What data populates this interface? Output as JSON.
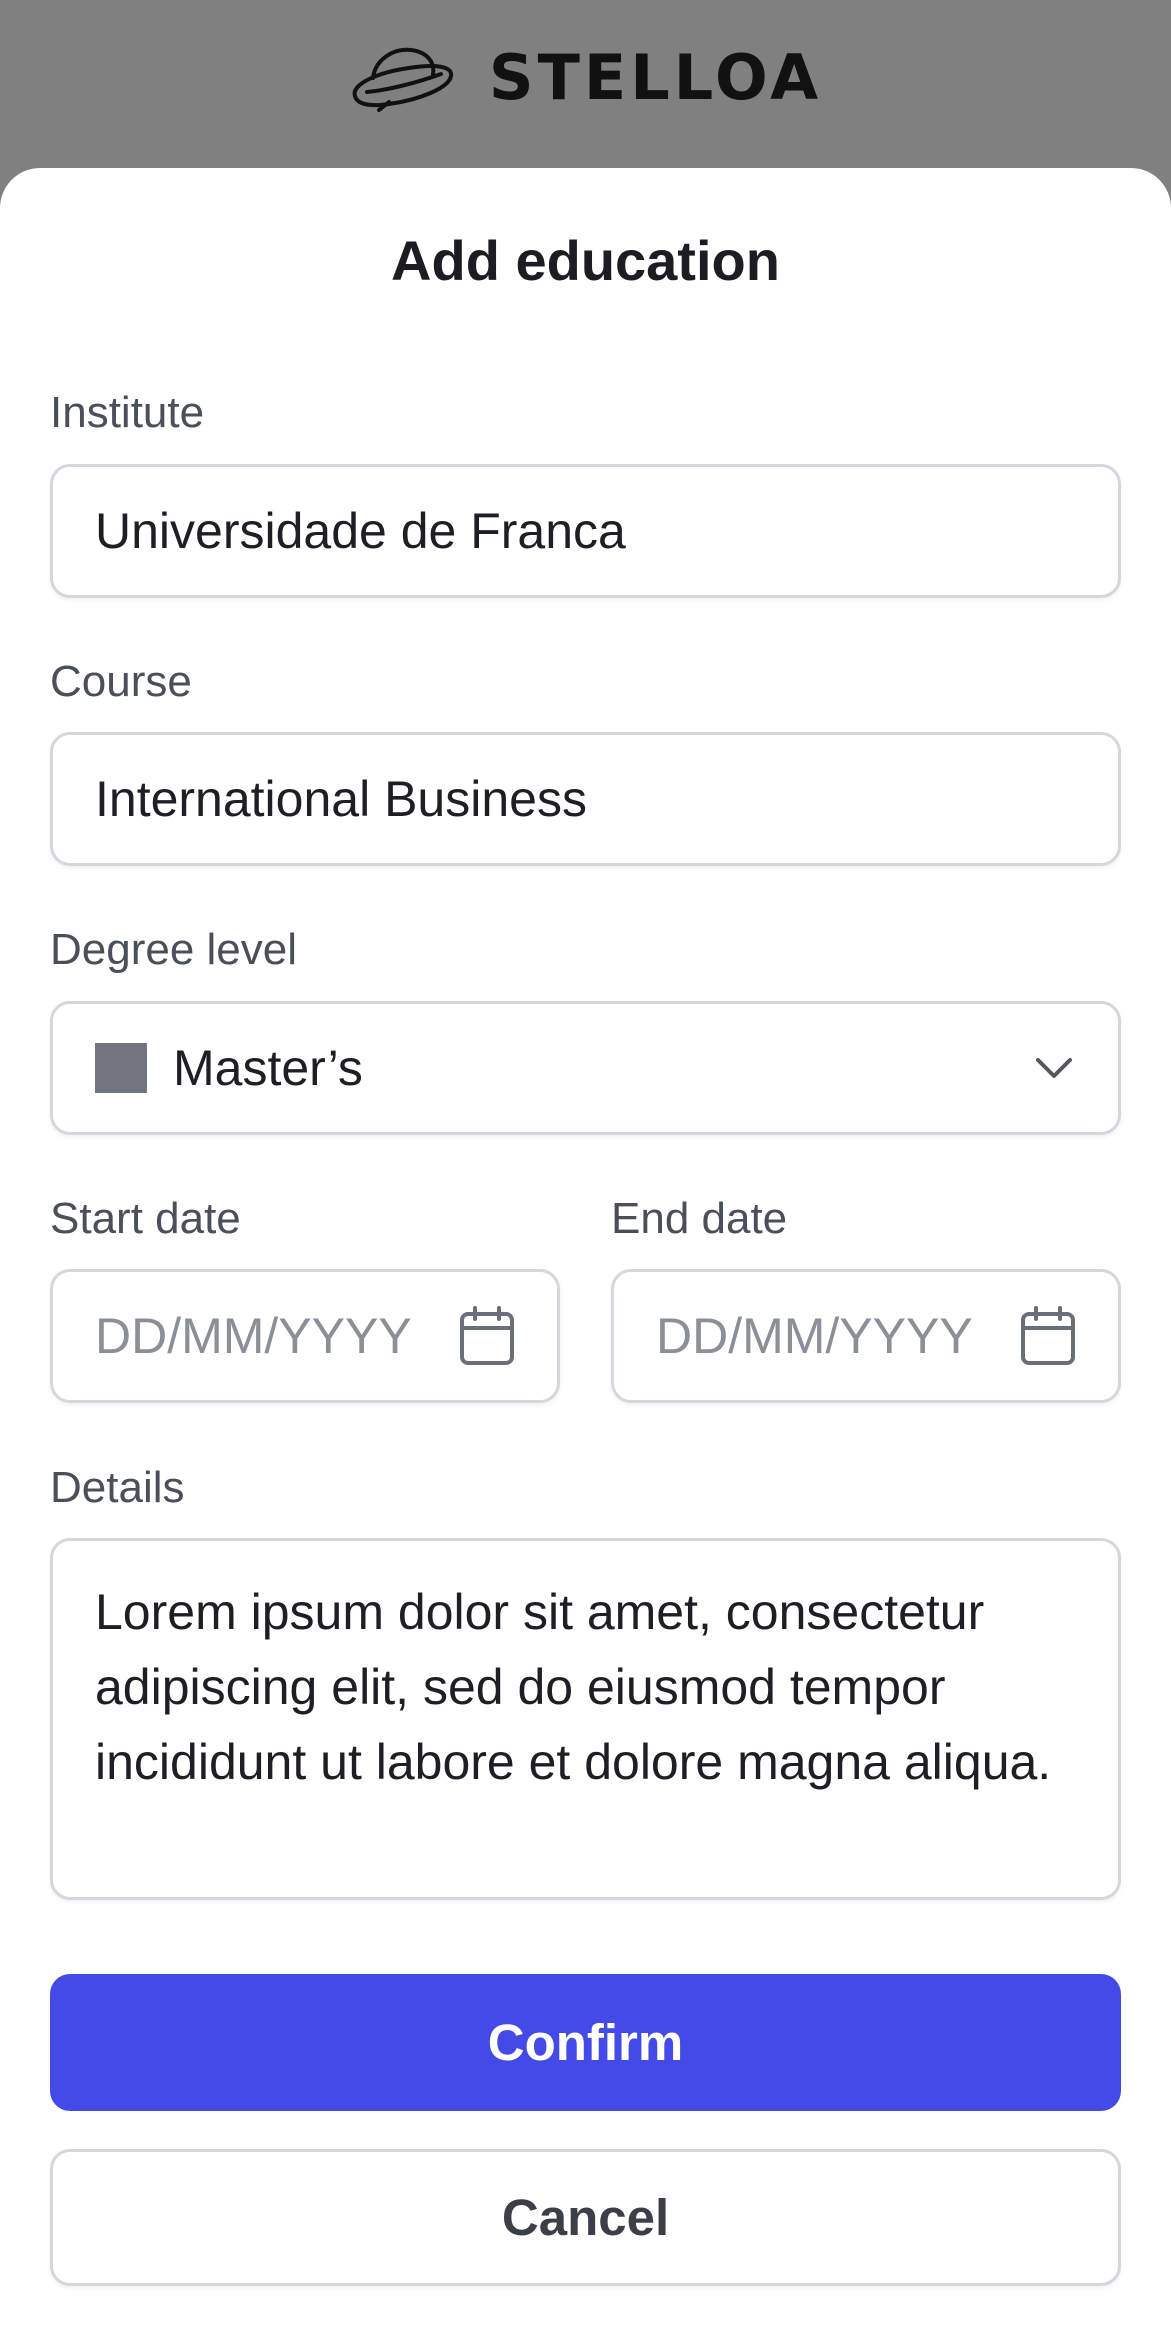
{
  "brand": {
    "name": "STELLOA",
    "logo_icon": "ufo-icon"
  },
  "dialog": {
    "title": "Add education"
  },
  "form": {
    "institute": {
      "label": "Institute",
      "value": "Universidade de Franca"
    },
    "course": {
      "label": "Course",
      "value": "International Business"
    },
    "degree_level": {
      "label": "Degree level",
      "value": "Master’s",
      "icon": "chevron-down-icon",
      "swatch_color": "#72757f"
    },
    "start_date": {
      "label": "Start date",
      "placeholder": "DD/MM/YYYY",
      "icon": "calendar-icon"
    },
    "end_date": {
      "label": "End date",
      "placeholder": "DD/MM/YYYY",
      "icon": "calendar-icon"
    },
    "details": {
      "label": "Details",
      "value": "Lorem ipsum dolor sit amet, consectetur adipiscing elit, sed do eiusmod tempor incididunt ut labore et dolore magna aliqua."
    }
  },
  "actions": {
    "confirm_label": "Confirm",
    "cancel_label": "Cancel"
  },
  "colors": {
    "overlay": "#808080",
    "primary": "#444ae6",
    "border": "#d6d7db"
  }
}
